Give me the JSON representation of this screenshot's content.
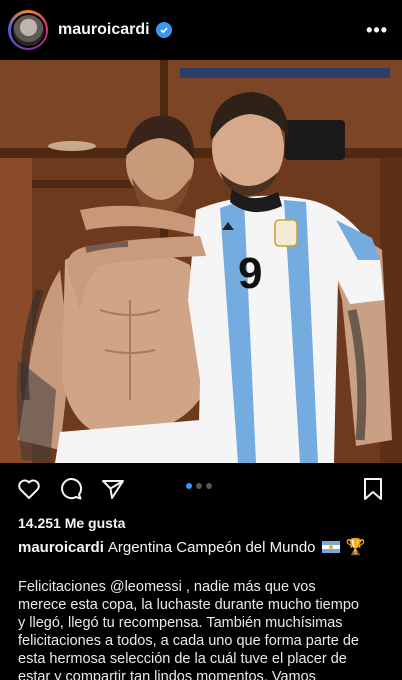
{
  "post": {
    "username": "mauroicardi",
    "more_label": "•••",
    "likes": "14.251 Me gusta",
    "caption_username": "mauroicardi",
    "caption_text": "Argentina Campeón del Mundo",
    "caption_emoji": "🏆",
    "body_lines": [
      "Felicitaciones @leomessi , nadie más que vos",
      "merece esta copa, la luchaste durante mucho tiempo",
      "y llegó, llegó tu recompensa. También muchísimas",
      "felicitaciones a todos, a cada uno que forma parte de",
      "esta hermosa selección de la cuál tuve el placer de",
      "estar y compartir tan lindos momentos. Vamos"
    ],
    "jersey_number": "9",
    "carousel": {
      "count": 3,
      "active": 1
    }
  },
  "icons": {
    "verified": "verified-badge-icon",
    "like": "heart-icon",
    "comment": "comment-icon",
    "share": "send-icon",
    "save": "bookmark-icon"
  },
  "colors": {
    "background": "#000000",
    "verified": "#3897f0",
    "carousel_active": "#3897f0",
    "argentina_blue": "#74acdf"
  }
}
